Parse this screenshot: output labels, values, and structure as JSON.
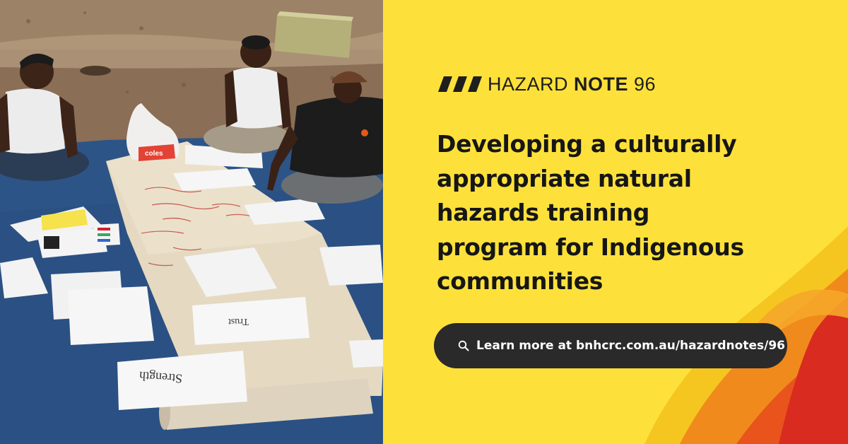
{
  "brand": {
    "word_light": "HAZARD",
    "word_bold": "NOTE",
    "number": "96",
    "slash_icon": "triple-slash-icon"
  },
  "headline": {
    "lines": [
      "Developing a culturally",
      "appropriate natural",
      "hazards training",
      "program for Indigenous",
      "communities"
    ]
  },
  "cta": {
    "icon": "search-icon",
    "label": "Learn more at bnhcrc.com.au/hazardnotes/96"
  },
  "photo": {
    "bag_label": "coles",
    "sheet_labels": [
      "Trust",
      "Strength"
    ]
  },
  "colors": {
    "background": "#fde13a",
    "text": "#161616",
    "button": "#2a2a2a",
    "button_text": "#ffffff",
    "flame_orange": "#f08a1c",
    "flame_red": "#d92b1f"
  }
}
